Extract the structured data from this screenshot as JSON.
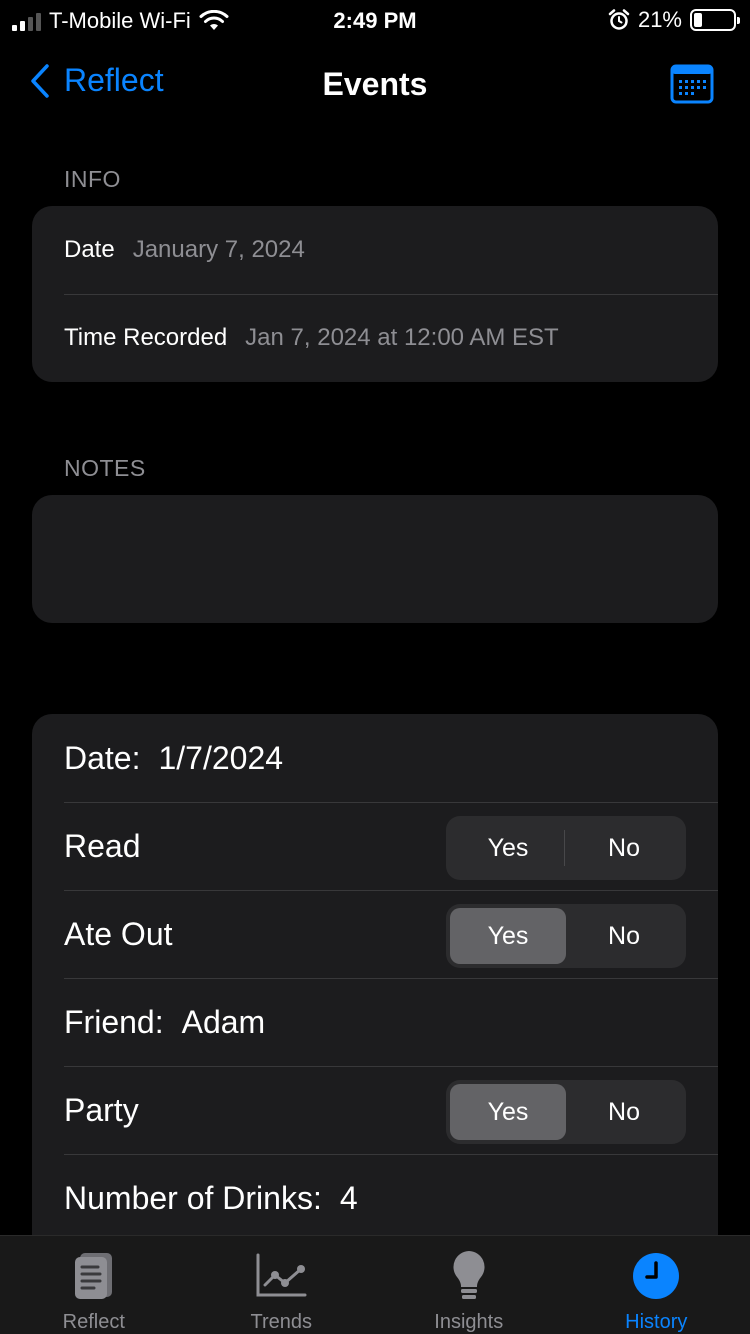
{
  "status_bar": {
    "carrier": "T-Mobile Wi-Fi",
    "time": "2:49 PM",
    "battery": "21%"
  },
  "nav": {
    "back_label": "Reflect",
    "title": "Events"
  },
  "info": {
    "header": "INFO",
    "date_label": "Date",
    "date_value": "January 7, 2024",
    "time_label": "Time Recorded",
    "time_value": "Jan 7, 2024 at 12:00 AM EST"
  },
  "notes": {
    "header": "NOTES",
    "value": ""
  },
  "events": {
    "date_label": "Date:",
    "date_value": "1/7/2024",
    "read_label": "Read",
    "ate_out_label": "Ate Out",
    "friend_label": "Friend:",
    "friend_value": "Adam",
    "party_label": "Party",
    "drinks_label": "Number of Drinks:",
    "drinks_value": "4",
    "yes": "Yes",
    "no": "No"
  },
  "tabs": [
    {
      "label": "Reflect",
      "icon": "journal-icon"
    },
    {
      "label": "Trends",
      "icon": "chart-line-icon"
    },
    {
      "label": "Insights",
      "icon": "lightbulb-icon"
    },
    {
      "label": "History",
      "icon": "clock-icon"
    }
  ],
  "colors": {
    "accent": "#0a84ff",
    "card": "#1c1c1e",
    "secondary_text": "#8e8e93"
  }
}
